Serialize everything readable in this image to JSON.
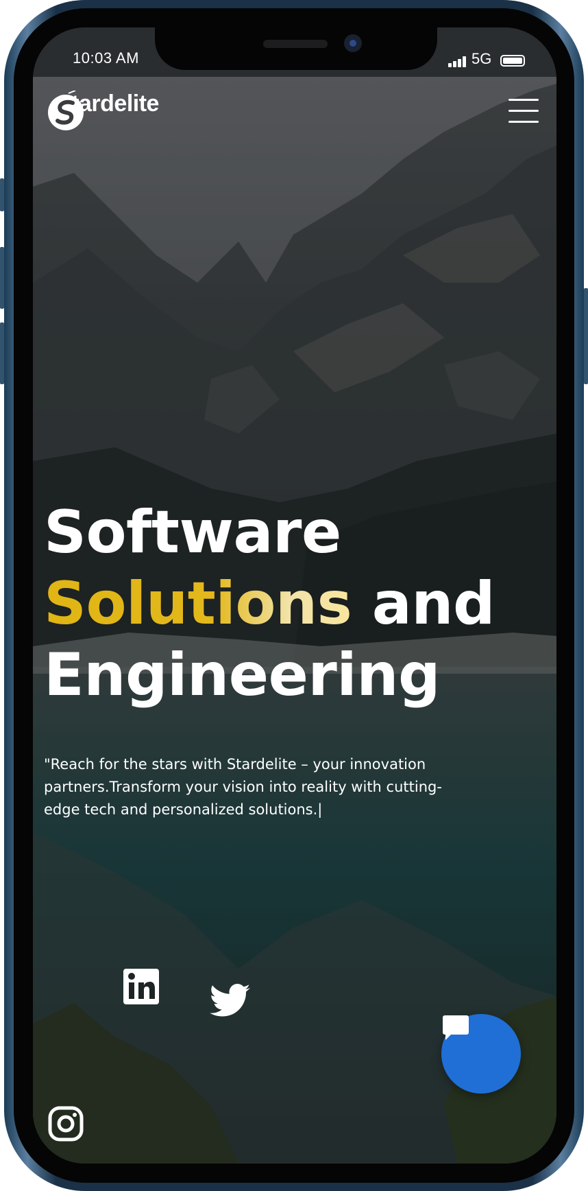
{
  "status_bar": {
    "time": "10:03 AM",
    "network": "5G",
    "icons": [
      "signal-icon",
      "battery-icon"
    ]
  },
  "header": {
    "brand": "Stardelite",
    "logo_icon": "stardelite-logo-icon",
    "menu_icon": "hamburger-menu-icon"
  },
  "hero": {
    "headline": {
      "line1": "Software",
      "accent": "Solutions",
      "line2_rest": " and",
      "line3": "Engineering"
    },
    "tagline": "\"Reach for the stars with Stardelite – your innovation partners.Transform your vision into reality with cutting-edge tech and personalized solutions.|"
  },
  "social": [
    {
      "name": "linkedin",
      "icon": "linkedin-icon"
    },
    {
      "name": "twitter",
      "icon": "twitter-icon"
    },
    {
      "name": "instagram",
      "icon": "instagram-icon"
    }
  ],
  "chat": {
    "icon": "chat-bubble-icon"
  },
  "colors": {
    "accent": "#e0b514",
    "chat_button": "#1f6fd6",
    "text": "#ffffff"
  }
}
